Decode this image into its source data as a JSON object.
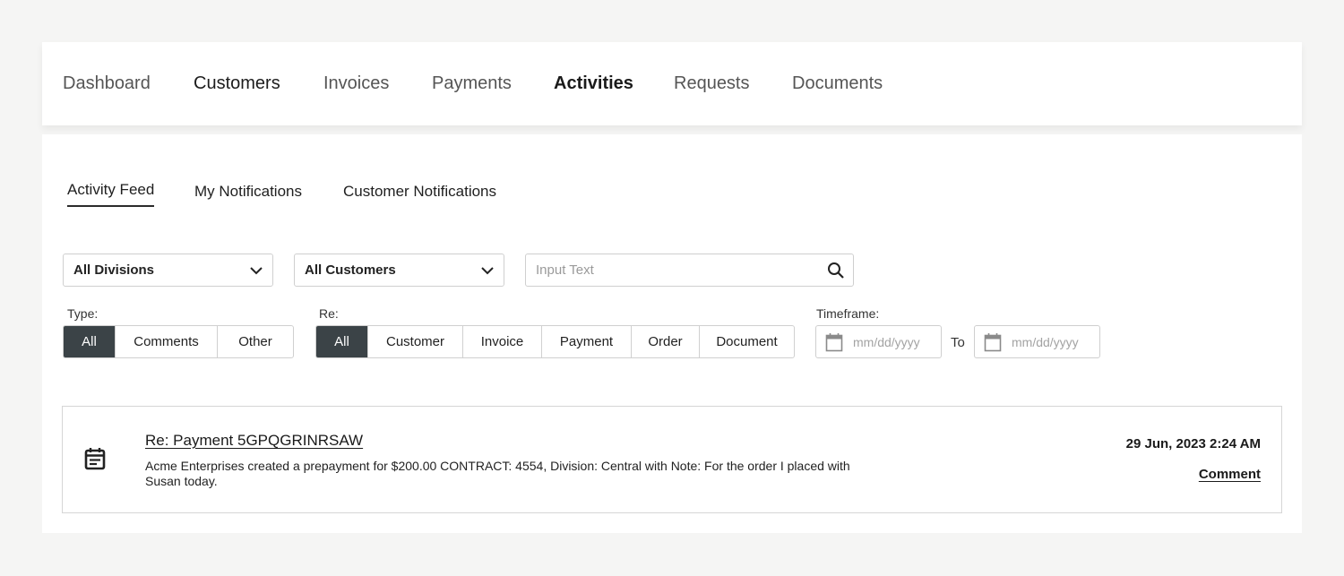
{
  "nav": {
    "items": [
      {
        "label": "Dashboard"
      },
      {
        "label": "Customers"
      },
      {
        "label": "Invoices"
      },
      {
        "label": "Payments"
      },
      {
        "label": "Activities"
      },
      {
        "label": "Requests"
      },
      {
        "label": "Documents"
      }
    ],
    "active": "Activities"
  },
  "tabs": [
    {
      "label": "Activity Feed",
      "active": true
    },
    {
      "label": "My Notifications",
      "active": false
    },
    {
      "label": "Customer Notifications",
      "active": false
    }
  ],
  "filters": {
    "division_select": {
      "value": "All Divisions"
    },
    "customer_select": {
      "value": "All Customers"
    },
    "search": {
      "value": "",
      "placeholder": "Input Text"
    },
    "type": {
      "label": "Type:",
      "options": [
        "All",
        "Comments",
        "Other"
      ],
      "selected": "All"
    },
    "re": {
      "label": "Re:",
      "options": [
        "All",
        "Customer",
        "Invoice",
        "Payment",
        "Order",
        "Document"
      ],
      "selected": "All"
    },
    "timeframe": {
      "label": "Timeframe:",
      "from": {
        "value": "",
        "placeholder": "mm/dd/yyyy"
      },
      "to_label": "To",
      "to": {
        "value": "",
        "placeholder": "mm/dd/yyyy"
      }
    }
  },
  "activity": {
    "icon": "document-icon",
    "title": "Re: Payment 5GPQGRINRSAW",
    "description": "Acme Enterprises created a prepayment for $200.00 CONTRACT: 4554, Division: Central with Note: For the order I placed with Susan today.",
    "timestamp": "29 Jun, 2023 2:24 AM",
    "comment_label": "Comment"
  },
  "colors": {
    "segment_selected_bg": "#3b4347",
    "page_bg": "#f5f5f4",
    "panel_bg": "#ffffff"
  }
}
